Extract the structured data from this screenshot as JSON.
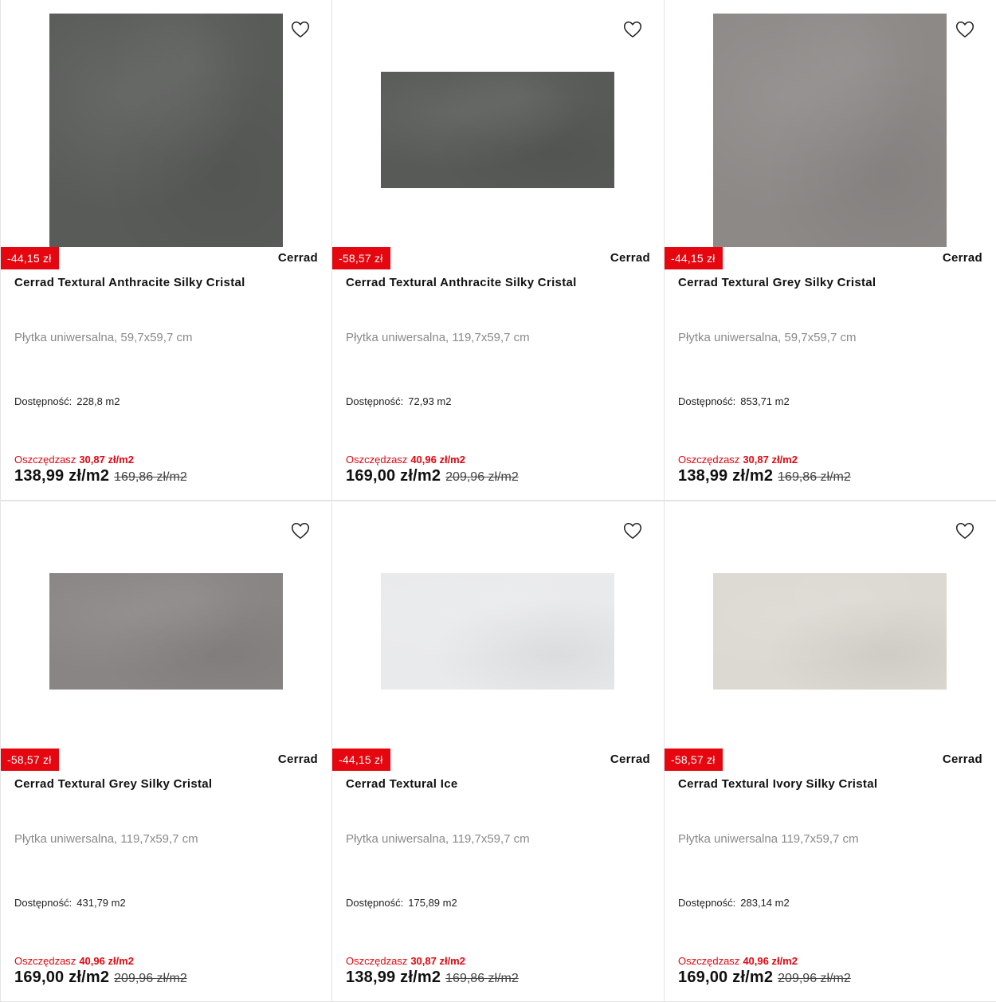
{
  "products": [
    {
      "badge": "-44,15 zł",
      "brand": "Cerrad",
      "title": "Cerrad Textural Anthracite Silky Cristal",
      "subtitle": "Płytka uniwersalna, 59,7x59,7 cm",
      "availability_label": "Dostępność:",
      "availability_value": "228,8 m2",
      "save_label": "Oszczędzasz",
      "save_amount": "30,87 zł/m2",
      "price": "138,99 zł/m2",
      "old_price": "169,86 zł/m2",
      "tile_shape": "square",
      "tile_color": "#595b59"
    },
    {
      "badge": "-58,57 zł",
      "brand": "Cerrad",
      "title": "Cerrad Textural Anthracite Silky Cristal",
      "subtitle": "Płytka uniwersalna, 119,7x59,7 cm",
      "availability_label": "Dostępność:",
      "availability_value": "72,93 m2",
      "save_label": "Oszczędzasz",
      "save_amount": "40,96 zł/m2",
      "price": "169,00 zł/m2",
      "old_price": "209,96 zł/m2",
      "tile_shape": "wide",
      "tile_color": "#575a57"
    },
    {
      "badge": "-44,15 zł",
      "brand": "Cerrad",
      "title": "Cerrad Textural Grey Silky Cristal",
      "subtitle": "Płytka uniwersalna, 59,7x59,7 cm",
      "availability_label": "Dostępność:",
      "availability_value": "853,71 m2",
      "save_label": "Oszczędzasz",
      "save_amount": "30,87 zł/m2",
      "price": "138,99 zł/m2",
      "old_price": "169,86 zł/m2",
      "tile_shape": "square",
      "tile_color": "#8c8987"
    },
    {
      "badge": "-58,57 zł",
      "brand": "Cerrad",
      "title": "Cerrad Textural Grey Silky Cristal",
      "subtitle": "Płytka uniwersalna, 119,7x59,7 cm",
      "availability_label": "Dostępność:",
      "availability_value": "431,79 m2",
      "save_label": "Oszczędzasz",
      "save_amount": "40,96 zł/m2",
      "price": "169,00 zł/m2",
      "old_price": "209,96 zł/m2",
      "tile_shape": "wide",
      "tile_color": "#898584"
    },
    {
      "badge": "-44,15 zł",
      "brand": "Cerrad",
      "title": "Cerrad Textural Ice",
      "subtitle": "Płytka uniwersalna, 119,7x59,7 cm",
      "availability_label": "Dostępność:",
      "availability_value": "175,89 m2",
      "save_label": "Oszczędzasz",
      "save_amount": "30,87 zł/m2",
      "price": "138,99 zł/m2",
      "old_price": "169,86 zł/m2",
      "tile_shape": "wide",
      "tile_color": "#e9eaeb"
    },
    {
      "badge": "-58,57 zł",
      "brand": "Cerrad",
      "title": "Cerrad Textural Ivory Silky Cristal",
      "subtitle": "Płytka uniwersalna 119,7x59,7 cm",
      "availability_label": "Dostępność:",
      "availability_value": "283,14 m2",
      "save_label": "Oszczędzasz",
      "save_amount": "40,96 zł/m2",
      "price": "169,00 zł/m2",
      "old_price": "209,96 zł/m2",
      "tile_shape": "wide",
      "tile_color": "#dcd9d2"
    }
  ]
}
